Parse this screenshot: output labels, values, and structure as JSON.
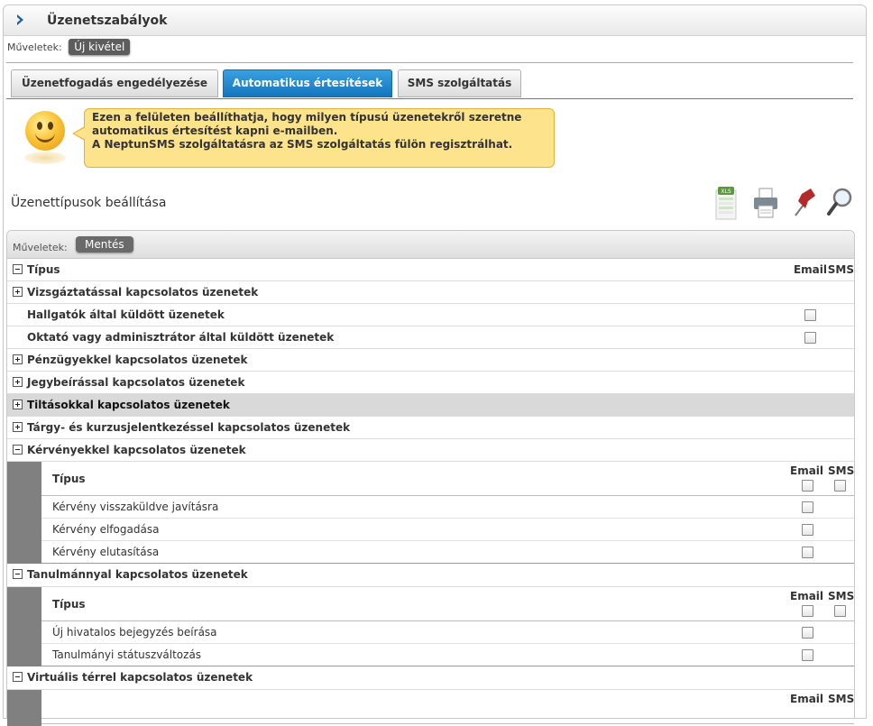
{
  "window": {
    "title": "Üzenetszabályok"
  },
  "toolbar": {
    "ops_label": "Műveletek:",
    "new_exception": "Új kivétel"
  },
  "tabs": [
    {
      "label": "Üzenetfogadás engedélyezése",
      "active": false
    },
    {
      "label": "Automatikus értesítések",
      "active": true
    },
    {
      "label": "SMS szolgáltatás",
      "active": false
    }
  ],
  "info": {
    "line1": "Ezen a felületen beállíthatja, hogy milyen típusú üzenetekről szeretne",
    "line2": "automatikus értesítést kapni e-mailben.",
    "line3": "A NeptunSMS szolgáltatásra az SMS szolgáltatás fülön regisztrálhat."
  },
  "section": {
    "title": "Üzenettípusok beállítása"
  },
  "tools": [
    "xls-export-icon",
    "print-icon",
    "pin-icon",
    "search-icon"
  ],
  "grid": {
    "ops_label": "Műveletek:",
    "save": "Mentés",
    "col_type": "Típus",
    "col_email": "Email",
    "col_sms": "SMS",
    "rows": [
      {
        "label": "Vizsgáztatással kapcsolatos üzenetek",
        "toggle": "plus"
      },
      {
        "label": "Hallgatók által küldött üzenetek",
        "toggle": "none",
        "email_checkbox": true
      },
      {
        "label": "Oktató vagy adminisztrátor által küldött üzenetek",
        "toggle": "none",
        "email_checkbox": true
      },
      {
        "label": "Pénzügyekkel kapcsolatos üzenetek",
        "toggle": "plus"
      },
      {
        "label": "Jegybeírással kapcsolatos üzenetek",
        "toggle": "plus"
      },
      {
        "label": "Tiltásokkal kapcsolatos üzenetek",
        "toggle": "plus",
        "highlighted": true
      },
      {
        "label": "Tárgy- és kurzusjelentkezéssel kapcsolatos üzenetek",
        "toggle": "plus"
      },
      {
        "label": "Kérvényekkel kapcsolatos üzenetek",
        "toggle": "minus"
      }
    ],
    "requests": {
      "header": {
        "type": "Típus",
        "email": "Email",
        "sms": "SMS"
      },
      "items": [
        "Kérvény visszaküldve javításra",
        "Kérvény elfogadása",
        "Kérvény elutasítása"
      ]
    },
    "studies_group": "Tanulmánnyal kapcsolatos üzenetek",
    "studies": {
      "header": {
        "type": "Típus",
        "email": "Email",
        "sms": "SMS"
      },
      "items": [
        "Új hivatalos bejegyzés beírása",
        "Tanulmányi státuszváltozás"
      ]
    },
    "virtual_group": "Virtuális térrel kapcsolatos üzenetek",
    "virtual": {
      "header": {
        "email": "Email",
        "sms": "SMS"
      }
    }
  }
}
